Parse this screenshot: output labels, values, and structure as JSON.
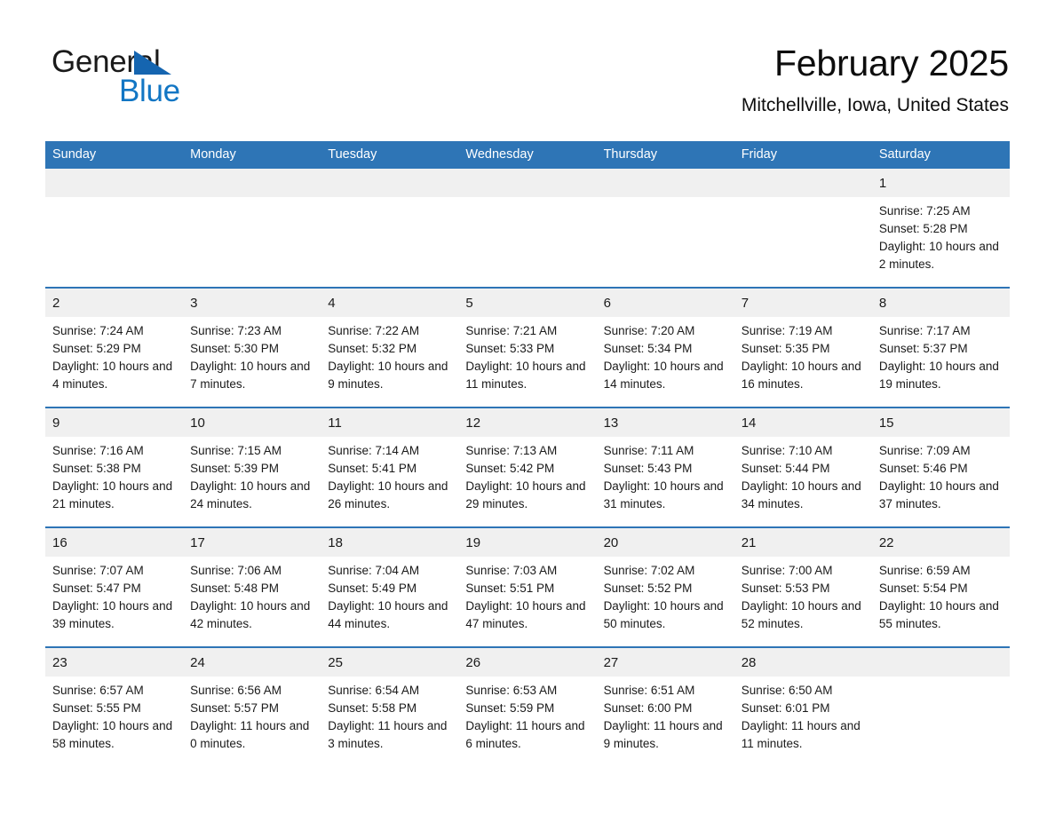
{
  "logo": {
    "word1": "General",
    "word2": "Blue",
    "triangle_color": "#1565b0",
    "blue_color": "#1276c4"
  },
  "header": {
    "title": "February 2025",
    "subtitle": "Mitchellville, Iowa, United States"
  },
  "theme": {
    "header_blue": "#2e75b6",
    "daynum_band": "#f0f0f0",
    "row_border": "#2e75b6"
  },
  "weekday_headers": [
    "Sunday",
    "Monday",
    "Tuesday",
    "Wednesday",
    "Thursday",
    "Friday",
    "Saturday"
  ],
  "labels": {
    "sunrise_prefix": "Sunrise: ",
    "sunset_prefix": "Sunset: ",
    "daylight_prefix": "Daylight: "
  },
  "weeks": [
    [
      {
        "day": ""
      },
      {
        "day": ""
      },
      {
        "day": ""
      },
      {
        "day": ""
      },
      {
        "day": ""
      },
      {
        "day": ""
      },
      {
        "day": "1",
        "sunrise": "Sunrise: 7:25 AM",
        "sunset": "Sunset: 5:28 PM",
        "daylight": "Daylight: 10 hours and 2 minutes."
      }
    ],
    [
      {
        "day": "2",
        "sunrise": "Sunrise: 7:24 AM",
        "sunset": "Sunset: 5:29 PM",
        "daylight": "Daylight: 10 hours and 4 minutes."
      },
      {
        "day": "3",
        "sunrise": "Sunrise: 7:23 AM",
        "sunset": "Sunset: 5:30 PM",
        "daylight": "Daylight: 10 hours and 7 minutes."
      },
      {
        "day": "4",
        "sunrise": "Sunrise: 7:22 AM",
        "sunset": "Sunset: 5:32 PM",
        "daylight": "Daylight: 10 hours and 9 minutes."
      },
      {
        "day": "5",
        "sunrise": "Sunrise: 7:21 AM",
        "sunset": "Sunset: 5:33 PM",
        "daylight": "Daylight: 10 hours and 11 minutes."
      },
      {
        "day": "6",
        "sunrise": "Sunrise: 7:20 AM",
        "sunset": "Sunset: 5:34 PM",
        "daylight": "Daylight: 10 hours and 14 minutes."
      },
      {
        "day": "7",
        "sunrise": "Sunrise: 7:19 AM",
        "sunset": "Sunset: 5:35 PM",
        "daylight": "Daylight: 10 hours and 16 minutes."
      },
      {
        "day": "8",
        "sunrise": "Sunrise: 7:17 AM",
        "sunset": "Sunset: 5:37 PM",
        "daylight": "Daylight: 10 hours and 19 minutes."
      }
    ],
    [
      {
        "day": "9",
        "sunrise": "Sunrise: 7:16 AM",
        "sunset": "Sunset: 5:38 PM",
        "daylight": "Daylight: 10 hours and 21 minutes."
      },
      {
        "day": "10",
        "sunrise": "Sunrise: 7:15 AM",
        "sunset": "Sunset: 5:39 PM",
        "daylight": "Daylight: 10 hours and 24 minutes."
      },
      {
        "day": "11",
        "sunrise": "Sunrise: 7:14 AM",
        "sunset": "Sunset: 5:41 PM",
        "daylight": "Daylight: 10 hours and 26 minutes."
      },
      {
        "day": "12",
        "sunrise": "Sunrise: 7:13 AM",
        "sunset": "Sunset: 5:42 PM",
        "daylight": "Daylight: 10 hours and 29 minutes."
      },
      {
        "day": "13",
        "sunrise": "Sunrise: 7:11 AM",
        "sunset": "Sunset: 5:43 PM",
        "daylight": "Daylight: 10 hours and 31 minutes."
      },
      {
        "day": "14",
        "sunrise": "Sunrise: 7:10 AM",
        "sunset": "Sunset: 5:44 PM",
        "daylight": "Daylight: 10 hours and 34 minutes."
      },
      {
        "day": "15",
        "sunrise": "Sunrise: 7:09 AM",
        "sunset": "Sunset: 5:46 PM",
        "daylight": "Daylight: 10 hours and 37 minutes."
      }
    ],
    [
      {
        "day": "16",
        "sunrise": "Sunrise: 7:07 AM",
        "sunset": "Sunset: 5:47 PM",
        "daylight": "Daylight: 10 hours and 39 minutes."
      },
      {
        "day": "17",
        "sunrise": "Sunrise: 7:06 AM",
        "sunset": "Sunset: 5:48 PM",
        "daylight": "Daylight: 10 hours and 42 minutes."
      },
      {
        "day": "18",
        "sunrise": "Sunrise: 7:04 AM",
        "sunset": "Sunset: 5:49 PM",
        "daylight": "Daylight: 10 hours and 44 minutes."
      },
      {
        "day": "19",
        "sunrise": "Sunrise: 7:03 AM",
        "sunset": "Sunset: 5:51 PM",
        "daylight": "Daylight: 10 hours and 47 minutes."
      },
      {
        "day": "20",
        "sunrise": "Sunrise: 7:02 AM",
        "sunset": "Sunset: 5:52 PM",
        "daylight": "Daylight: 10 hours and 50 minutes."
      },
      {
        "day": "21",
        "sunrise": "Sunrise: 7:00 AM",
        "sunset": "Sunset: 5:53 PM",
        "daylight": "Daylight: 10 hours and 52 minutes."
      },
      {
        "day": "22",
        "sunrise": "Sunrise: 6:59 AM",
        "sunset": "Sunset: 5:54 PM",
        "daylight": "Daylight: 10 hours and 55 minutes."
      }
    ],
    [
      {
        "day": "23",
        "sunrise": "Sunrise: 6:57 AM",
        "sunset": "Sunset: 5:55 PM",
        "daylight": "Daylight: 10 hours and 58 minutes."
      },
      {
        "day": "24",
        "sunrise": "Sunrise: 6:56 AM",
        "sunset": "Sunset: 5:57 PM",
        "daylight": "Daylight: 11 hours and 0 minutes."
      },
      {
        "day": "25",
        "sunrise": "Sunrise: 6:54 AM",
        "sunset": "Sunset: 5:58 PM",
        "daylight": "Daylight: 11 hours and 3 minutes."
      },
      {
        "day": "26",
        "sunrise": "Sunrise: 6:53 AM",
        "sunset": "Sunset: 5:59 PM",
        "daylight": "Daylight: 11 hours and 6 minutes."
      },
      {
        "day": "27",
        "sunrise": "Sunrise: 6:51 AM",
        "sunset": "Sunset: 6:00 PM",
        "daylight": "Daylight: 11 hours and 9 minutes."
      },
      {
        "day": "28",
        "sunrise": "Sunrise: 6:50 AM",
        "sunset": "Sunset: 6:01 PM",
        "daylight": "Daylight: 11 hours and 11 minutes."
      },
      {
        "day": ""
      }
    ]
  ]
}
